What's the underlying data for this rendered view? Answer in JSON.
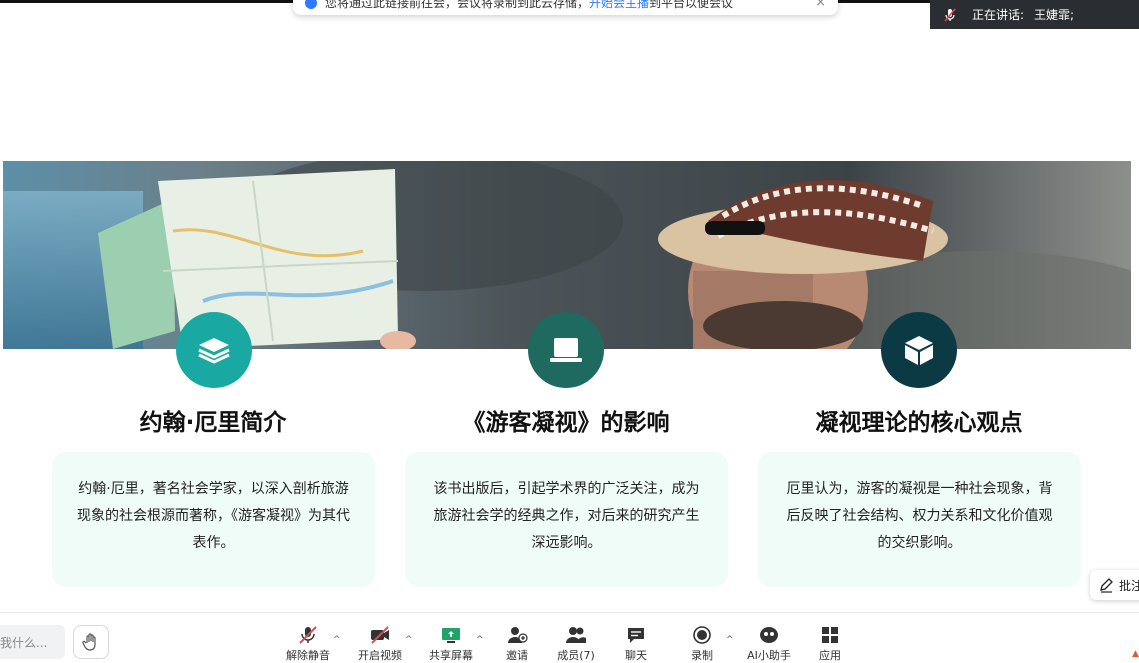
{
  "notice": {
    "text": "您将通过此链接前往会，会议将录制到此云存储，",
    "link": "开始会主播",
    "text_after": "到平台以便会议",
    "close_icon": "close-icon"
  },
  "speaker": {
    "label": "正在讲话:",
    "name": "王婕霏;"
  },
  "slide": {
    "sections": [
      {
        "icon": "layers-icon",
        "circle_color": "#1aa9a2",
        "title": "约翰·厄里简介",
        "body": "约翰·厄里，著名社会学家，以深入剖析旅游现象的社会根源而著称，《游客凝视》为其代表作。"
      },
      {
        "icon": "laptop-icon",
        "circle_color": "#1f6a5e",
        "title": "《游客凝视》的影响",
        "body": "该书出版后，引起学术界的广泛关注，成为旅游社会学的经典之作，对后来的研究产生深远影响。"
      },
      {
        "icon": "cube-icon",
        "circle_color": "#0b3a44",
        "title": "凝视理论的核心观点",
        "body": "厄里认为，游客的凝视是一种社会现象，背后反映了社会结构、权力关系和文化价值观的交织影响。"
      }
    ]
  },
  "annotate": {
    "label": "批注"
  },
  "chat": {
    "placeholder": "我什么..."
  },
  "toolbar": {
    "items": [
      {
        "label": "解除静音",
        "icon": "mic-muted-icon"
      },
      {
        "label": "开启视频",
        "icon": "video-off-icon"
      },
      {
        "label": "共享屏幕",
        "icon": "share-screen-icon"
      },
      {
        "label": "邀请",
        "icon": "invite-icon"
      },
      {
        "label": "成员(7)",
        "icon": "members-icon"
      },
      {
        "label": "聊天",
        "icon": "chat-icon"
      },
      {
        "label": "录制",
        "icon": "record-icon"
      },
      {
        "label": "AI小助手",
        "icon": "ai-assistant-icon"
      },
      {
        "label": "应用",
        "icon": "apps-icon"
      }
    ]
  },
  "colors": {
    "accent": "#1aa9a2",
    "card_bg": "#f0fcf8",
    "speaker_bg": "#2a2d32"
  }
}
